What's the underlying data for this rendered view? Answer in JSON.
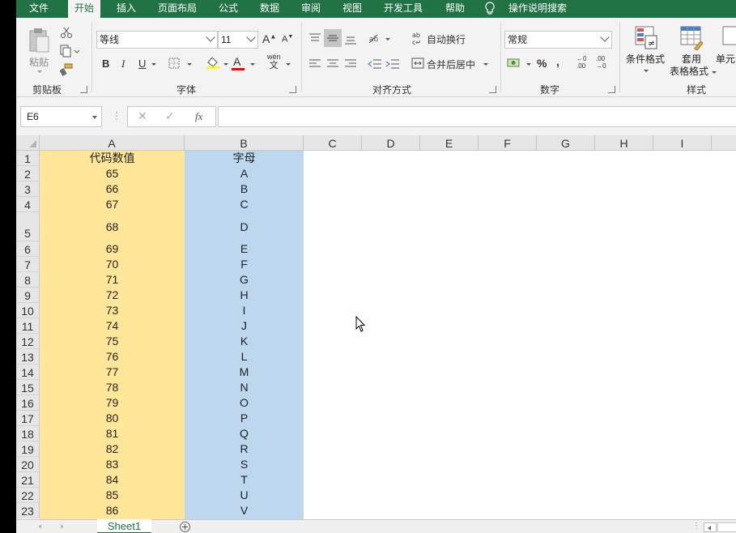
{
  "ribbon_tabs": [
    {
      "label": "文件",
      "active": false
    },
    {
      "label": "开始",
      "active": true
    },
    {
      "label": "插入",
      "active": false
    },
    {
      "label": "页面布局",
      "active": false
    },
    {
      "label": "公式",
      "active": false
    },
    {
      "label": "数据",
      "active": false
    },
    {
      "label": "审阅",
      "active": false
    },
    {
      "label": "视图",
      "active": false
    },
    {
      "label": "开发工具",
      "active": false
    },
    {
      "label": "帮助",
      "active": false
    }
  ],
  "tell_me": "操作说明搜索",
  "clipboard": {
    "paste_label": "粘贴",
    "group_label": "剪贴板"
  },
  "font": {
    "font_name": "等线",
    "font_size": "11",
    "group_label": "字体",
    "bold": "B",
    "italic": "I",
    "underline": "U",
    "increase": "A",
    "decrease": "A",
    "wen": "wén",
    "wen_char": "文"
  },
  "alignment": {
    "wrap_text": "自动换行",
    "merge_center": "合并后居中",
    "group_label": "对齐方式"
  },
  "number": {
    "format": "常规",
    "group_label": "数字",
    "percent": "%",
    "comma": ",",
    "inc_decimal_top": "←0",
    "inc_decimal_bottom": ".00",
    "dec_decimal_top": ".00",
    "dec_decimal_bottom": "→0"
  },
  "styles": {
    "conditional_format": "条件格式",
    "table_format_line1": "套用",
    "table_format_line2": "表格格式",
    "cell_styles": "单元",
    "group_label": "样式"
  },
  "formula_bar": {
    "name_box": "E6",
    "cancel": "✕",
    "confirm": "✓",
    "fx": "fx",
    "formula": ""
  },
  "columns": [
    "A",
    "B",
    "C",
    "D",
    "E",
    "F",
    "G",
    "H",
    "I"
  ],
  "header_row": {
    "row": "1",
    "a": "代码数值",
    "b": "字母"
  },
  "rows": [
    {
      "row": "2",
      "code": "65",
      "letter": "A"
    },
    {
      "row": "3",
      "code": "66",
      "letter": "B"
    },
    {
      "row": "4",
      "code": "67",
      "letter": "C"
    },
    {
      "row": "5",
      "code": "68",
      "letter": "D"
    },
    {
      "row": "6",
      "code": "69",
      "letter": "E"
    },
    {
      "row": "7",
      "code": "70",
      "letter": "F"
    },
    {
      "row": "8",
      "code": "71",
      "letter": "G"
    },
    {
      "row": "9",
      "code": "72",
      "letter": "H"
    },
    {
      "row": "10",
      "code": "73",
      "letter": "I"
    },
    {
      "row": "11",
      "code": "74",
      "letter": "J"
    },
    {
      "row": "12",
      "code": "75",
      "letter": "K"
    },
    {
      "row": "13",
      "code": "76",
      "letter": "L"
    },
    {
      "row": "14",
      "code": "77",
      "letter": "M"
    },
    {
      "row": "15",
      "code": "78",
      "letter": "N"
    },
    {
      "row": "16",
      "code": "79",
      "letter": "O"
    },
    {
      "row": "17",
      "code": "80",
      "letter": "P"
    },
    {
      "row": "18",
      "code": "81",
      "letter": "Q"
    },
    {
      "row": "19",
      "code": "82",
      "letter": "R"
    },
    {
      "row": "20",
      "code": "83",
      "letter": "S"
    },
    {
      "row": "21",
      "code": "84",
      "letter": "T"
    },
    {
      "row": "22",
      "code": "85",
      "letter": "U"
    },
    {
      "row": "23",
      "code": "86",
      "letter": "V"
    }
  ],
  "sheet_tab": "Sheet1",
  "colors": {
    "ribbon_green": "#217346",
    "col_a_fill": "#ffe699",
    "col_b_fill": "#bdd7ee"
  }
}
